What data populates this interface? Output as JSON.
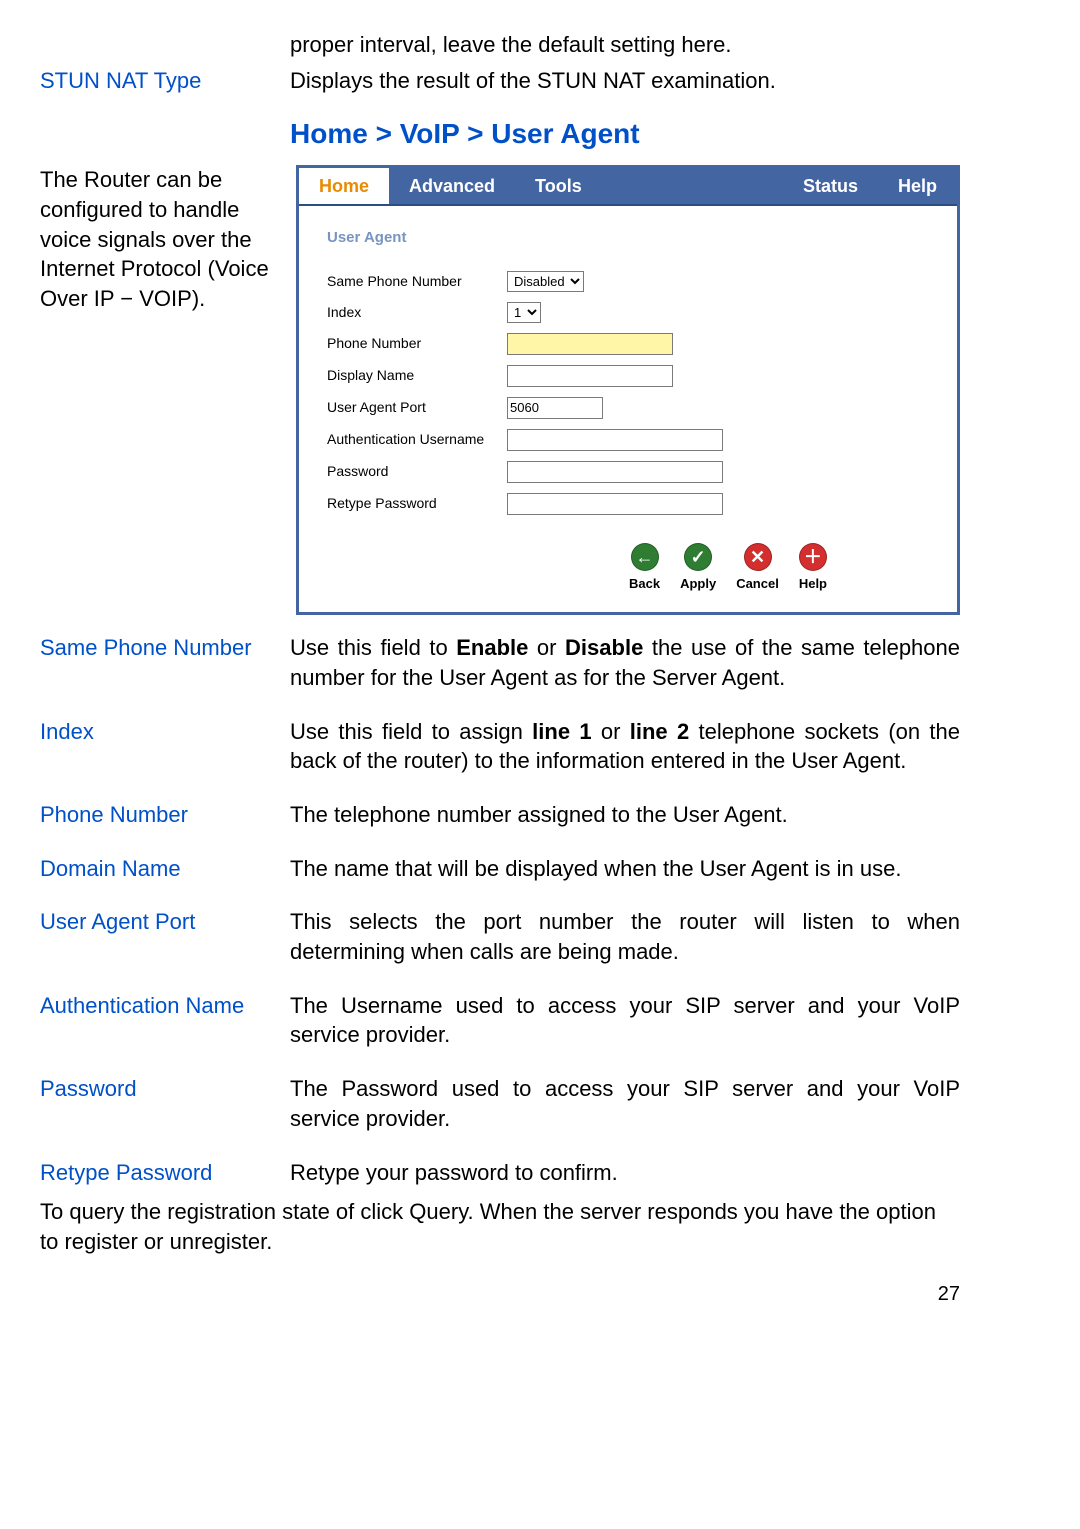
{
  "top": {
    "interval_sentence": "proper interval, leave the default setting here.",
    "stun_label": "STUN NAT Type",
    "stun_desc": "Displays the result of the STUN NAT examination."
  },
  "breadcrumb": "Home > VoIP > User Agent",
  "intro": "The Router can be configured to handle voice signals over the Internet Protocol (Voice Over IP − VOIP).",
  "screenshot": {
    "tabs": {
      "home": "Home",
      "advanced": "Advanced",
      "tools": "Tools",
      "status": "Status",
      "help": "Help"
    },
    "panel_title": "User Agent",
    "fields": {
      "same_phone_label": "Same Phone Number",
      "same_phone_value": "Disabled",
      "index_label": "Index",
      "index_value": "1",
      "phone_label": "Phone Number",
      "phone_value": "",
      "display_label": "Display Name",
      "display_value": "",
      "port_label": "User Agent Port",
      "port_value": "5060",
      "auth_label": "Authentication Username",
      "auth_value": "",
      "pw_label": "Password",
      "pw_value": "",
      "rpw_label": "Retype Password",
      "rpw_value": ""
    },
    "buttons": {
      "back": "Back",
      "apply": "Apply",
      "cancel": "Cancel",
      "help": "Help"
    }
  },
  "defs": {
    "same_phone": {
      "label": "Same Phone Number",
      "pre": "Use this field to ",
      "b1": "Enable",
      "mid": " or ",
      "b2": "Disable",
      "post": " the use of the same telephone number for the User Agent as for the Server Agent."
    },
    "index": {
      "label": "Index",
      "pre": "Use this field to assign ",
      "b1": "line 1",
      "mid": " or ",
      "b2": "line 2",
      "post": " telephone sockets (on the back of the router) to the information entered in the User Agent."
    },
    "phone": {
      "label": "Phone Number",
      "text": "The telephone number assigned to the User Agent."
    },
    "domain": {
      "label": "Domain Name",
      "text": "The name that will be displayed when the User Agent is in use."
    },
    "port": {
      "label": "User Agent Port",
      "text": "This selects the port number the router will listen to when determining when calls are being made."
    },
    "auth": {
      "label": "Authentication Name",
      "text": "The Username used to access your SIP server and your VoIP service provider."
    },
    "pw": {
      "label": "Password",
      "text": "The Password used to access your SIP server and your VoIP service provider."
    },
    "rpw": {
      "label": "Retype Password",
      "text": "Retype your password to confirm."
    }
  },
  "footnote": "To query the registration state of click Query. When the server responds you have the option to register or unregister.",
  "page_num": "27"
}
